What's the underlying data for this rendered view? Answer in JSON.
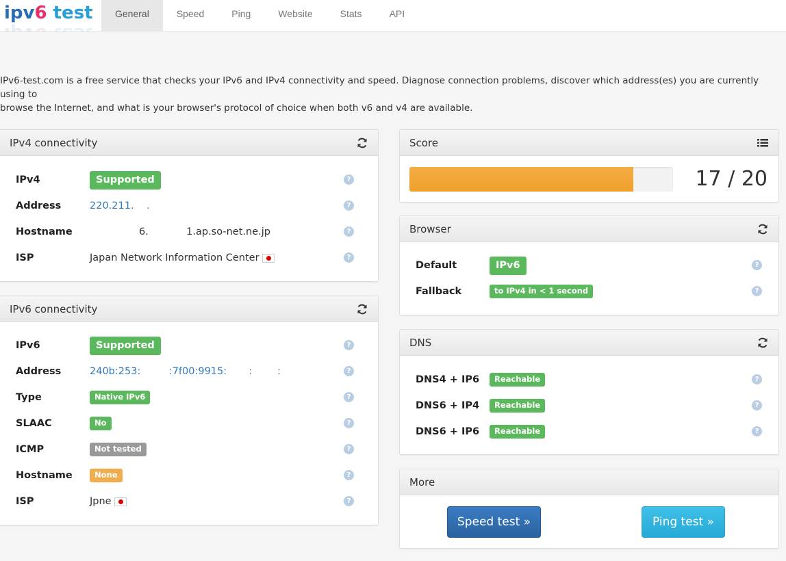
{
  "logo": {
    "ip": "ipv",
    "v6": "6",
    "test": " test"
  },
  "nav": {
    "tabs": [
      "General",
      "Speed",
      "Ping",
      "Website",
      "Stats",
      "API"
    ],
    "active": 0
  },
  "intro": {
    "line1": "IPv6-test.com is a free service that checks your IPv6 and IPv4 connectivity and speed. Diagnose connection problems, discover which address(es) you are currently using to",
    "line2": "browse the Internet, and what is your browser's protocol of choice when both v6 and v4 are available."
  },
  "ipv4": {
    "title": "IPv4 connectivity",
    "rows": [
      {
        "label": "IPv4",
        "value": "Supported"
      },
      {
        "label": "Address",
        "value": "220.211.    ."
      },
      {
        "label": "Hostname",
        "value": "6.            1.ap.so-net.ne.jp"
      },
      {
        "label": "ISP",
        "value": "Japan Network Information Center"
      }
    ]
  },
  "ipv6": {
    "title": "IPv6 connectivity",
    "rows": [
      {
        "label": "IPv6",
        "value": "Supported"
      },
      {
        "label": "Address",
        "value": "240b:253:         :7f00:9915:       :        :"
      },
      {
        "label": "Type",
        "value": "Native IPv6"
      },
      {
        "label": "SLAAC",
        "value": "No"
      },
      {
        "label": "ICMP",
        "value": "Not tested"
      },
      {
        "label": "Hostname",
        "value": "None"
      },
      {
        "label": "ISP",
        "value": "Jpne"
      }
    ]
  },
  "score": {
    "title": "Score",
    "text": "17 / 20",
    "value": 17,
    "max": 20
  },
  "browser": {
    "title": "Browser",
    "rows": [
      {
        "label": "Default",
        "value": "IPv6"
      },
      {
        "label": "Fallback",
        "value": "to IPv4 in < 1 second"
      }
    ]
  },
  "dns": {
    "title": "DNS",
    "rows": [
      {
        "label": "DNS4 + IP6",
        "value": "Reachable"
      },
      {
        "label": "DNS6 + IP4",
        "value": "Reachable"
      },
      {
        "label": "DNS6 + IP6",
        "value": "Reachable"
      }
    ]
  },
  "more": {
    "title": "More",
    "speed_button": "Speed test »",
    "ping_button": "Ping test »"
  },
  "help_glyph": "?",
  "icons": {
    "refresh": "refresh-icon",
    "list": "list-icon",
    "help": "help-icon",
    "flag": "japan-flag-icon"
  },
  "colors": {
    "success": "#5cb85c",
    "default": "#999999",
    "warning": "#f0ad4e",
    "progress": "#eea02b",
    "link": "#337ab7"
  }
}
